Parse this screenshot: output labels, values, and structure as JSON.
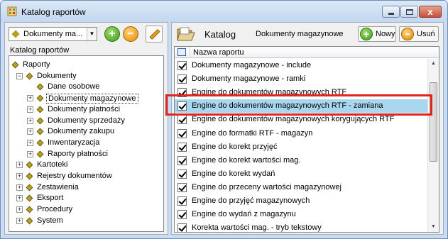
{
  "window": {
    "title": "Katalog raportów",
    "controls": {
      "minimize": "minimize",
      "maximize": "maximize",
      "close": "x"
    }
  },
  "left": {
    "dropdown_value": "Dokumenty ma...",
    "panel_label": "Katalog raportów",
    "tree": [
      {
        "label": "Raporty",
        "level": 0,
        "expander": "",
        "selected": false
      },
      {
        "label": "Dokumenty",
        "level": 1,
        "expander": "−",
        "selected": false
      },
      {
        "label": "Dane osobowe",
        "level": 2,
        "expander": "",
        "selected": false
      },
      {
        "label": "Dokumenty magazynowe",
        "level": 2,
        "expander": "+",
        "selected": true
      },
      {
        "label": "Dokumenty płatności",
        "level": 2,
        "expander": "+",
        "selected": false
      },
      {
        "label": "Dokumenty sprzedaży",
        "level": 2,
        "expander": "+",
        "selected": false
      },
      {
        "label": "Dokumenty zakupu",
        "level": 2,
        "expander": "+",
        "selected": false
      },
      {
        "label": "Inwentaryzacja",
        "level": 2,
        "expander": "+",
        "selected": false
      },
      {
        "label": "Raporty płatności",
        "level": 2,
        "expander": "+",
        "selected": false
      },
      {
        "label": "Kartoteki",
        "level": 1,
        "expander": "+",
        "selected": false
      },
      {
        "label": "Rejestry dokumentów",
        "level": 1,
        "expander": "+",
        "selected": false
      },
      {
        "label": "Zestawienia",
        "level": 1,
        "expander": "+",
        "selected": false
      },
      {
        "label": "Eksport",
        "level": 1,
        "expander": "+",
        "selected": false
      },
      {
        "label": "Procedury",
        "level": 1,
        "expander": "+",
        "selected": false
      },
      {
        "label": "System",
        "level": 1,
        "expander": "+",
        "selected": false
      }
    ]
  },
  "right": {
    "title": "Katalog",
    "subtitle": "Dokumenty magazynowe",
    "new_button": "Nowy",
    "delete_button": "Usuń",
    "column_header": "Nazwa raportu",
    "rows": [
      {
        "name": "Dokumenty magazynowe - include",
        "checked": true,
        "highlighted": false
      },
      {
        "name": "Dokumenty magazynowe - ramki",
        "checked": true,
        "highlighted": false
      },
      {
        "name": "Engine do dokumentów magazynowych RTF",
        "checked": true,
        "highlighted": false
      },
      {
        "name": "Engine do dokumentów magazynowych RTF - zamiana",
        "checked": true,
        "highlighted": true
      },
      {
        "name": "Engine do dokumentów magazynowych korygujących RTF",
        "checked": true,
        "highlighted": false
      },
      {
        "name": "Engine do formatki RTF - magazyn",
        "checked": true,
        "highlighted": false
      },
      {
        "name": "Engine do korekt przyjęć",
        "checked": true,
        "highlighted": false
      },
      {
        "name": "Engine do korekt wartości mag.",
        "checked": true,
        "highlighted": false
      },
      {
        "name": "Engine do korekt wydań",
        "checked": true,
        "highlighted": false
      },
      {
        "name": "Engine do przeceny wartości magazynowej",
        "checked": true,
        "highlighted": false
      },
      {
        "name": "Engine do przyjęć magazynowych",
        "checked": true,
        "highlighted": false
      },
      {
        "name": "Engine do wydań z magazynu",
        "checked": true,
        "highlighted": false
      },
      {
        "name": "Korekta wartości mag. - tryb tekstowy",
        "checked": true,
        "highlighted": false
      }
    ]
  },
  "colors": {
    "selection_highlight": "#a9d7f0",
    "annotation_red": "#e1241e",
    "tree_node_diamond": "#b5a12a"
  }
}
